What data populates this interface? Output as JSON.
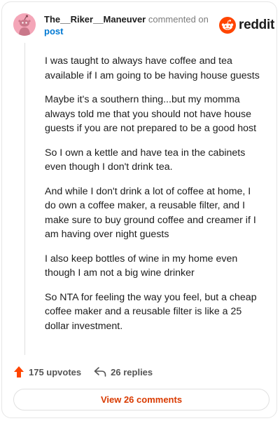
{
  "comment": {
    "username": "The__Riker__Maneuver",
    "action_text": "commented on",
    "target_link": "post",
    "paragraphs": [
      "I was taught to always have coffee and tea available if I am going to be having house guests",
      "Maybe it's a southern thing...but my momma always told me that you should not have house guests if you are not prepared to be a good host",
      "So I own a kettle and have tea in the cabinets even though I don't drink tea.",
      "And while I don't drink a lot of coffee at home, I do own a coffee maker, a reusable filter, and I make sure to buy ground coffee and creamer if I am having over night guests",
      "I also keep bottles of wine in my home even though I am not a big wine drinker",
      "So NTA for feeling the way you feel, but a cheap coffee maker and a reusable filter is like a 25 dollar investment."
    ]
  },
  "brand": {
    "name": "reddit",
    "icon": "reddit-alien-icon",
    "color": "#ff4500"
  },
  "stats": {
    "upvotes": "175 upvotes",
    "replies": "26 replies",
    "upvote_icon": "upvote-arrow-icon",
    "reply_icon": "reply-arrow-icon",
    "upvote_color": "#ff4500"
  },
  "footer": {
    "view_comments": "View 26 comments",
    "link_color": "#d93a00"
  },
  "avatar": {
    "icon": "snoo-avatar-icon",
    "background": "#f4a6b8"
  }
}
